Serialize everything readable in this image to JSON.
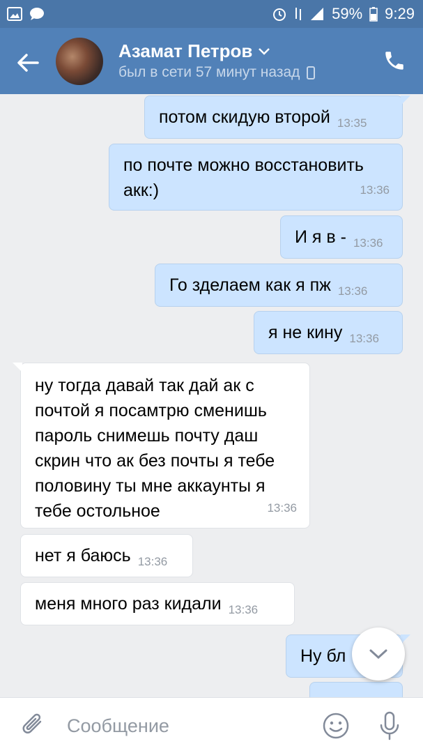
{
  "status_bar": {
    "battery": "59%",
    "time": "9:29",
    "left_icons": [
      "gallery-icon",
      "chat-bubble-icon"
    ],
    "right_icons": [
      "alarm-icon",
      "data-arrows-icon",
      "signal-icon",
      "battery-icon"
    ]
  },
  "header": {
    "contact_name": "Азамат Петров",
    "last_seen": "был в сети 57 минут назад",
    "colors": {
      "header_bg": "#5181b8",
      "status_bar_bg": "#4a76a8"
    }
  },
  "messages": [
    {
      "direction": "out",
      "text": "потом скидую второй",
      "time": "13:35"
    },
    {
      "direction": "out",
      "text": "по почте можно восстановить акк:)",
      "time": "13:36"
    },
    {
      "direction": "out",
      "text": "И я в -",
      "time": "13:36"
    },
    {
      "direction": "out",
      "text": "Го зделаем как я пж",
      "time": "13:36"
    },
    {
      "direction": "out",
      "text": "я не кину",
      "time": "13:36"
    },
    {
      "direction": "in",
      "text": "ну тогда давай так дай ак с почтой я посамтрю сменишь пароль снимешь почту даш скрин что ак без почты я тебе половину ты мне аккаунты я тебе остольное",
      "time": "13:36"
    },
    {
      "direction": "in",
      "text": "нет я баюсь",
      "time": "13:36"
    },
    {
      "direction": "in",
      "text": "меня много раз кидали",
      "time": "13:36"
    },
    {
      "direction": "out",
      "text": "Ну бл",
      "time": ""
    },
    {
      "direction": "out",
      "text": "",
      "time": ""
    }
  ],
  "composer": {
    "placeholder": "Сообщение"
  },
  "colors": {
    "outgoing_bubble": "#cce4ff",
    "incoming_bubble": "#ffffff",
    "chat_bg": "#edeef0",
    "timestamp": "#939aa3"
  }
}
